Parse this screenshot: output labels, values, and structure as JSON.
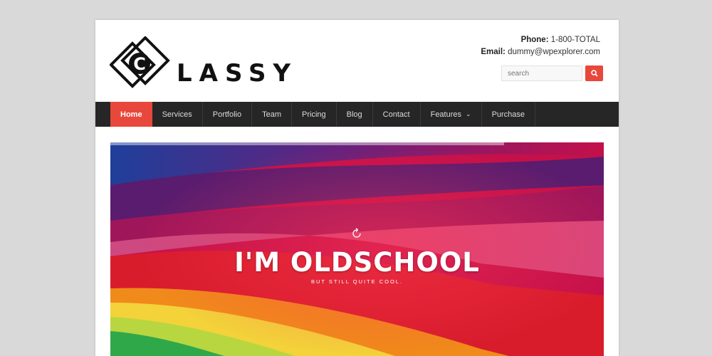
{
  "site": {
    "logo_text": "LASSY",
    "logo_letter": "C"
  },
  "contact": {
    "phone_label": "Phone:",
    "phone_value": "1-800-TOTAL",
    "email_label": "Email:",
    "email_value": "dummy@wpexplorer.com"
  },
  "search": {
    "placeholder": "search",
    "button_icon": "search-icon"
  },
  "nav": {
    "items": [
      {
        "label": "Home",
        "active": true
      },
      {
        "label": "Services"
      },
      {
        "label": "Portfolio"
      },
      {
        "label": "Team"
      },
      {
        "label": "Pricing"
      },
      {
        "label": "Blog"
      },
      {
        "label": "Contact"
      },
      {
        "label": "Features",
        "dropdown": true
      },
      {
        "label": "Purchase"
      }
    ]
  },
  "hero": {
    "title": "I'M OLDSCHOOL",
    "subtitle": "BUT STILL QUITE COOL.",
    "icon": "refresh-icon"
  },
  "colors": {
    "accent": "#e8473b",
    "nav_bg": "#262626",
    "page_bg": "#d9d9d9"
  }
}
